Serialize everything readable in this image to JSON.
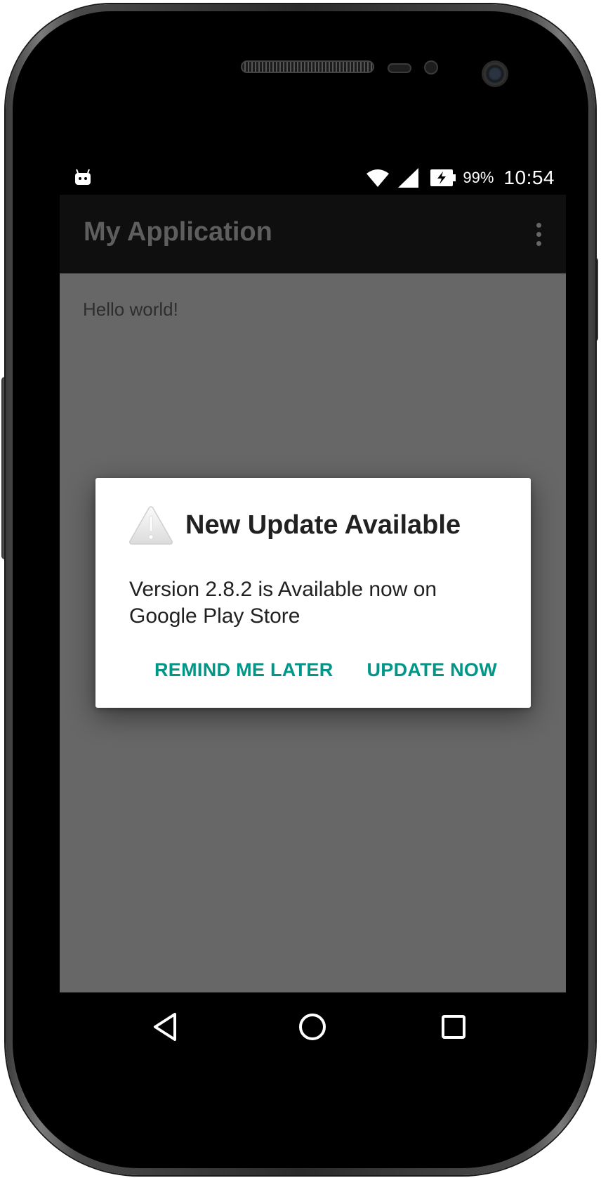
{
  "status_bar": {
    "battery_percent": "99%",
    "time": "10:54",
    "icons": [
      "android-notification-icon",
      "wifi-icon",
      "cell-signal-icon",
      "battery-charging-icon"
    ]
  },
  "app_bar": {
    "title": "My Application",
    "overflow_icon": "overflow-menu-icon"
  },
  "content": {
    "text": "Hello world!"
  },
  "dialog": {
    "icon": "warning-icon",
    "title": "New Update Available",
    "message": "Version 2.8.2 is Available now on Google Play Store",
    "buttons": {
      "negative": "REMIND ME LATER",
      "positive": "UPDATE NOW"
    },
    "accent_color": "#009688"
  },
  "nav_bar": {
    "icons": [
      "back-icon",
      "home-icon",
      "recents-icon"
    ]
  }
}
